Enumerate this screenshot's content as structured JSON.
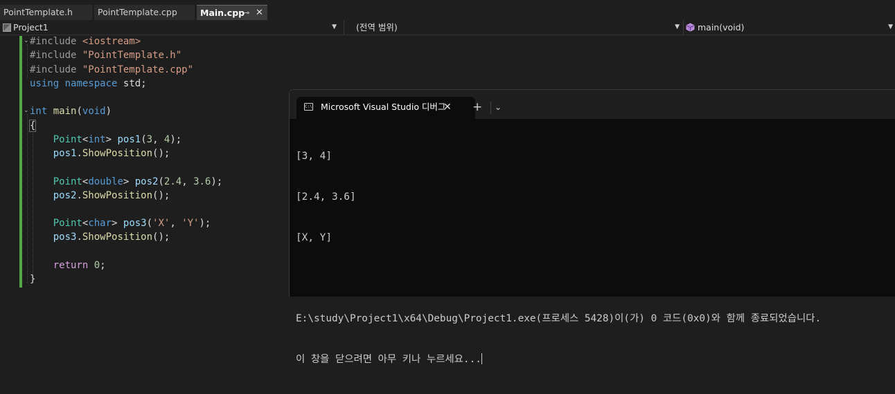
{
  "editor_tabs": [
    {
      "label": "PointTemplate.h",
      "active": false
    },
    {
      "label": "PointTemplate.cpp",
      "active": false
    },
    {
      "label": "Main.cpp",
      "active": true
    }
  ],
  "navbar": {
    "project": "Project1",
    "scope": "(전역 범위)",
    "function": "main(void)"
  },
  "code": {
    "l1_pre": "#include",
    "l1_hdr": "<iostream>",
    "l2_pre": "#include",
    "l2_hdr": "\"PointTemplate.h\"",
    "l3_pre": "#include",
    "l3_hdr": "\"PointTemplate.cpp\"",
    "l4_using": "using",
    "l4_namespace": "namespace",
    "l4_std": "std;",
    "l6_int": "int",
    "l6_main": "main",
    "l6_void": "void",
    "l7_brace": "{",
    "l8_type": "Point",
    "l8_arg": "int",
    "l8_var": "pos1",
    "l8_a": "3",
    "l8_b": "4",
    "l9_obj": "pos1",
    "l9_fn": "ShowPosition",
    "l11_type": "Point",
    "l11_arg": "double",
    "l11_var": "pos2",
    "l11_a": "2.4",
    "l11_b": "3.6",
    "l12_obj": "pos2",
    "l12_fn": "ShowPosition",
    "l14_type": "Point",
    "l14_arg": "char",
    "l14_var": "pos3",
    "l14_a": "'X'",
    "l14_b": "'Y'",
    "l15_obj": "pos3",
    "l15_fn": "ShowPosition",
    "l17_return": "return",
    "l17_val": "0",
    "l18_brace": "}"
  },
  "terminal": {
    "tab_title": "Microsoft Visual Studio 디버그",
    "icon_text": "C:\\",
    "lines": [
      "[3, 4]",
      "[2.4, 3.6]",
      "[X, Y]",
      "",
      "E:\\study\\Project1\\x64\\Debug\\Project1.exe(프로세스 5428)이(가) 0 코드(0x0)와 함께 종료되었습니다.",
      "이 창을 닫으려면 아무 키나 누르세요..."
    ]
  },
  "colors": {
    "editor_bg": "#1e1e1e",
    "terminal_bg": "#0c0c0c",
    "keyword": "#569cd6",
    "type": "#4ec9b0",
    "string": "#d69d85",
    "change_bar": "#57a64a"
  }
}
